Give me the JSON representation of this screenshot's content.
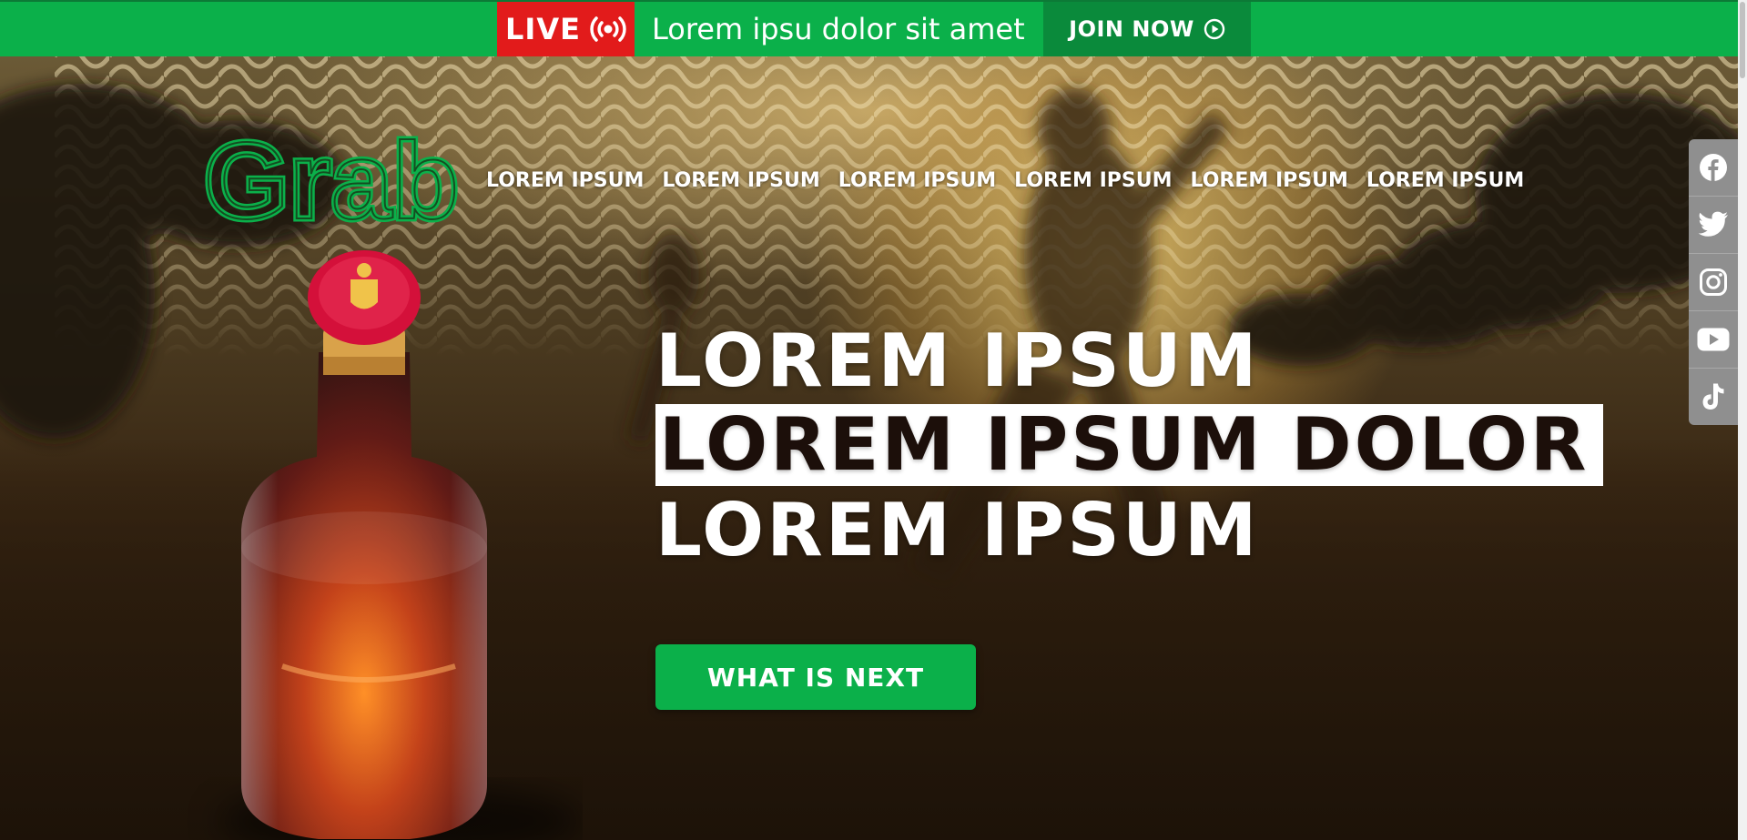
{
  "topbar": {
    "live_label": "LIVE",
    "message": "Lorem ipsu dolor sit amet",
    "join_label": "JOIN NOW",
    "broadcast_icon": "broadcast-icon",
    "play_icon": "play-circle-icon"
  },
  "brand": {
    "logo_text": "Grab"
  },
  "nav": {
    "items": [
      {
        "label": "LOREM IPSUM"
      },
      {
        "label": "LOREM IPSUM"
      },
      {
        "label": "LOREM IPSUM"
      },
      {
        "label": "LOREM IPSUM"
      },
      {
        "label": "LOREM IPSUM"
      },
      {
        "label": "LOREM IPSUM"
      }
    ]
  },
  "hero": {
    "line1": "LOREM IPSUM",
    "line2": "LOREM IPSUM DOLOR",
    "line3": "LOREM IPSUM",
    "cta_label": "WHAT IS NEXT"
  },
  "social": [
    "facebook-icon",
    "twitter-icon",
    "instagram-icon",
    "youtube-icon",
    "tiktok-icon"
  ],
  "colors": {
    "brand_green": "#0bb04a",
    "live_red": "#e21b1b",
    "join_dark_green": "#0a8a3b",
    "social_bg": "#8f8f8f"
  }
}
